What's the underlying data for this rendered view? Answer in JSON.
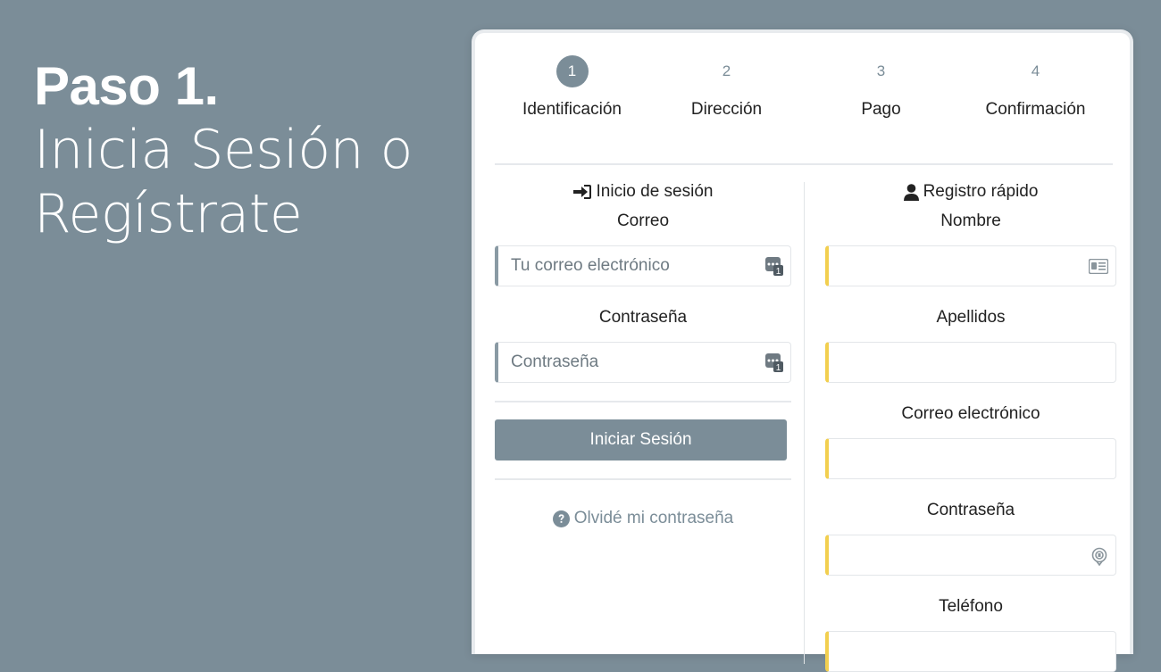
{
  "hero": {
    "step": "Paso 1.",
    "subtitle_line1": "Inicia Sesión o",
    "subtitle_line2": "Regístrate"
  },
  "steps": [
    {
      "number": "1",
      "label": "Identificación",
      "active": true
    },
    {
      "number": "2",
      "label": "Dirección",
      "active": false
    },
    {
      "number": "3",
      "label": "Pago",
      "active": false
    },
    {
      "number": "4",
      "label": "Confirmación",
      "active": false
    }
  ],
  "login": {
    "title": "Inicio de sesión",
    "email_label": "Correo",
    "email_placeholder": "Tu correo electrónico",
    "password_label": "Contraseña",
    "password_placeholder": "Contraseña",
    "submit_label": "Iniciar Sesión",
    "forgot_label": "Olvidé mi contraseña"
  },
  "register": {
    "title": "Registro rápido",
    "name_label": "Nombre",
    "lastname_label": "Apellidos",
    "email_label": "Correo electrónico",
    "password_label": "Contraseña",
    "phone_label": "Teléfono"
  },
  "colors": {
    "background": "#7b8d98",
    "accent": "#7b8d98",
    "required_marker": "#f2cf4f"
  },
  "icons": {
    "login_title": "sign-in-icon",
    "register_title": "user-icon",
    "password_manager": "password-manager-icon",
    "id_card": "id-card-icon",
    "fingerprint": "fingerprint-key-icon",
    "help": "question-circle-icon"
  }
}
